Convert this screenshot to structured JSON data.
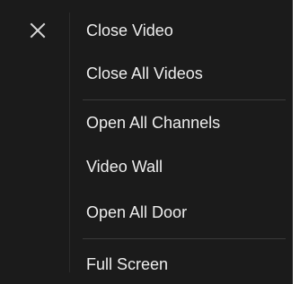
{
  "menu": {
    "items": [
      {
        "label": "Close Video",
        "icon": "close-icon"
      },
      {
        "label": "Close All Videos"
      },
      {
        "label": "Open All Channels"
      },
      {
        "label": "Video Wall"
      },
      {
        "label": "Open All Door"
      },
      {
        "label": "Full Screen"
      }
    ]
  },
  "colors": {
    "background": "#1b1b1b",
    "text": "#eeeeee",
    "separator": "#3a3a3a"
  }
}
